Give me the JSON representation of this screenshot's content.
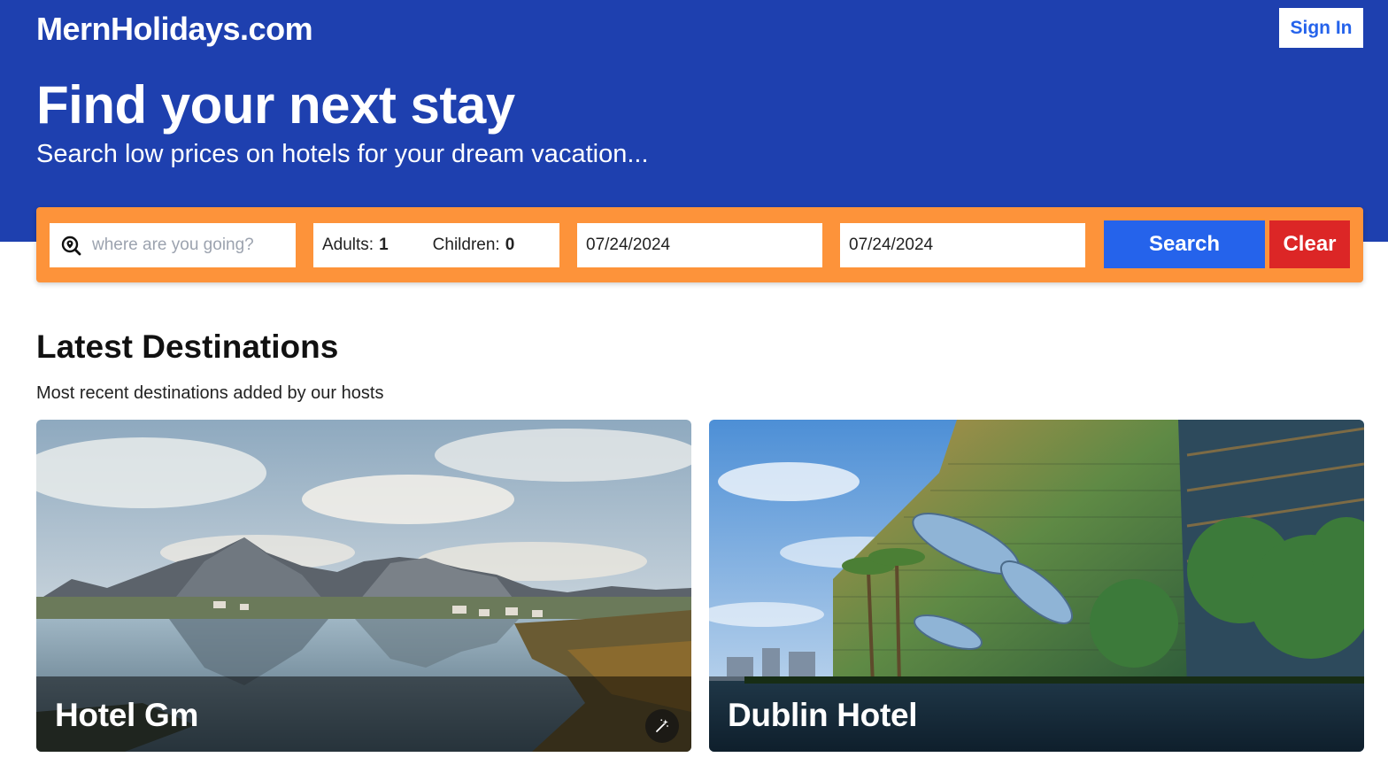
{
  "header": {
    "brand": "MernHolidays.com",
    "signin_label": "Sign In",
    "headline": "Find your next stay",
    "subheadline": "Search low prices on hotels for your dream vacation..."
  },
  "search": {
    "destination_placeholder": "where are you going?",
    "destination_value": "",
    "adults_label": "Adults:",
    "adults_value": "1",
    "children_label": "Children:",
    "children_value": "0",
    "check_in": "07/24/2024",
    "check_out": "07/24/2024",
    "search_label": "Search",
    "clear_label": "Clear"
  },
  "latest": {
    "title": "Latest Destinations",
    "subtitle": "Most recent destinations added by our hosts",
    "cards": [
      {
        "name": "Hotel Gm"
      },
      {
        "name": "Dublin Hotel"
      }
    ]
  },
  "colors": {
    "hero_blue": "#1e40af",
    "search_orange": "#fd933a",
    "search_button": "#2563eb",
    "clear_button": "#dc2626"
  },
  "icons": [
    "search-location-icon",
    "magic-wand-icon"
  ]
}
